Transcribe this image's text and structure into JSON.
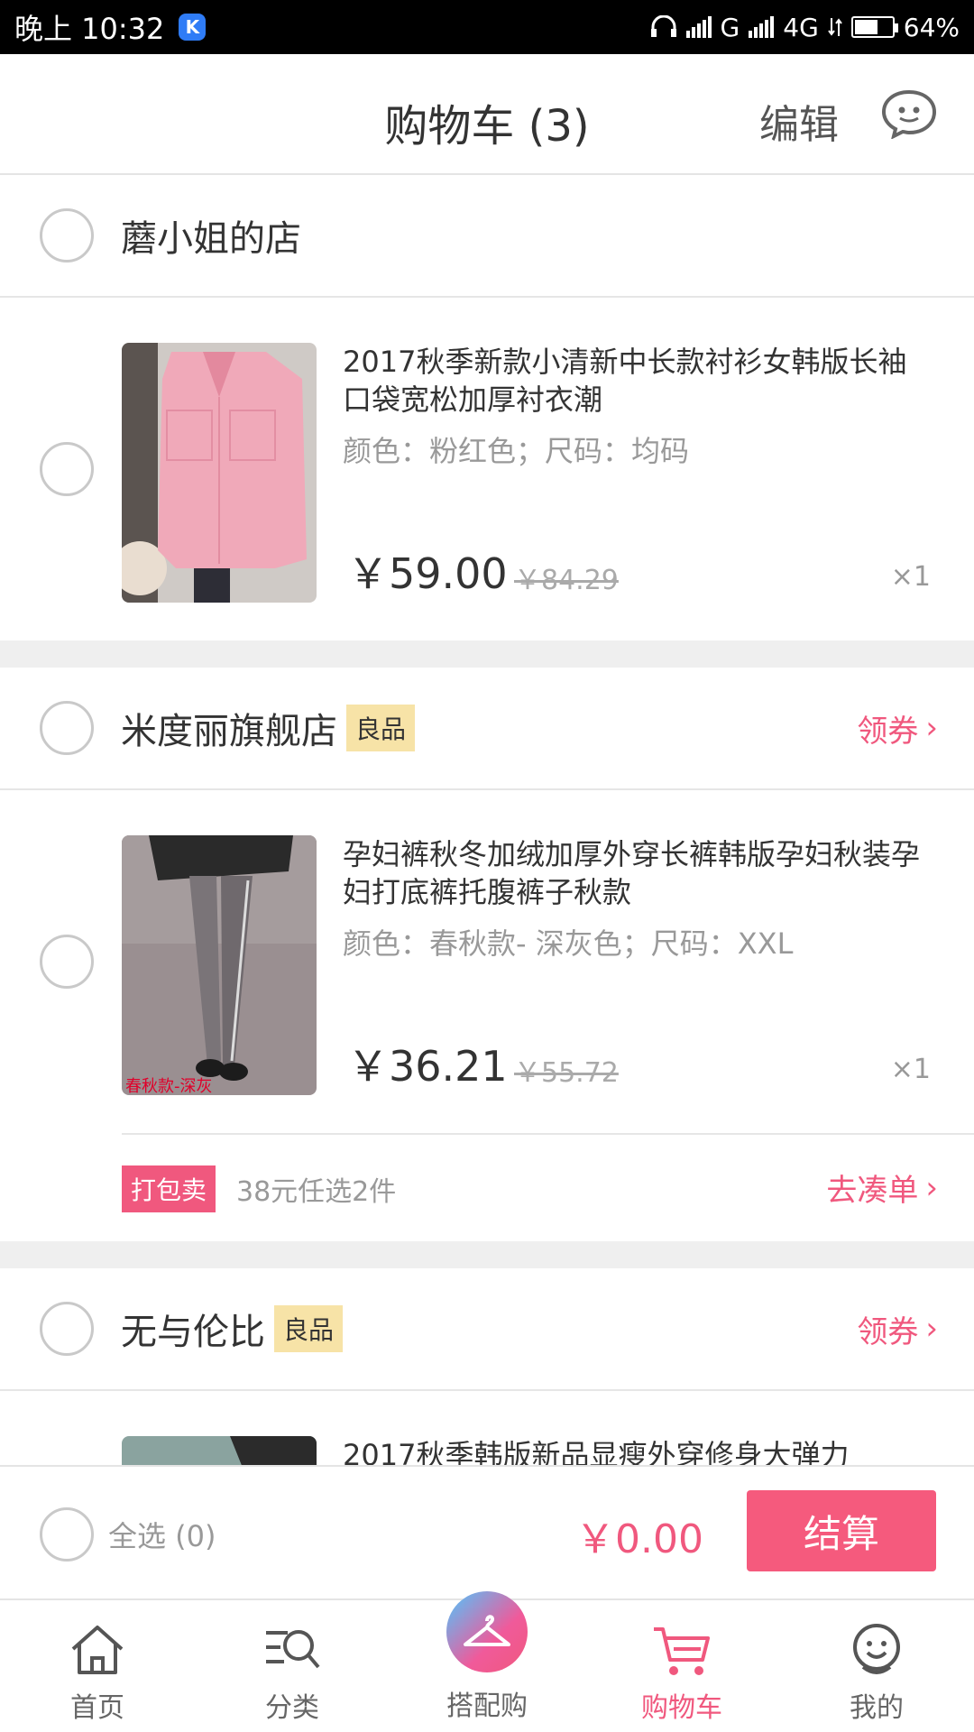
{
  "status_bar": {
    "time": "晚上 10:32",
    "network": "G",
    "network2": "4G",
    "battery": "64%",
    "battery_level": 0.64
  },
  "header": {
    "title": "购物车 (3)",
    "edit": "编辑"
  },
  "shops": [
    {
      "name": "蘑小姐的店",
      "items": [
        {
          "name": "2017秋季新款小清新中长款衬衫女韩版长袖口袋宽松加厚衬衣潮",
          "spec": "颜色：粉红色；尺码：均码",
          "price": "￥59.00",
          "original_price": "￥84.29",
          "qty": "×1"
        }
      ]
    },
    {
      "name": "米度丽旗舰店",
      "tag": "良品",
      "coupon": "领券",
      "items": [
        {
          "name": "孕妇裤秋冬加绒加厚外穿长裤韩版孕妇秋装孕妇打底裤托腹裤子秋款",
          "spec": "颜色：春秋款- 深灰色；尺码：XXL",
          "price": "￥36.21",
          "original_price": "￥55.72",
          "qty": "×1",
          "image_caption": "春秋款-深灰"
        }
      ],
      "bundle": {
        "badge": "打包卖",
        "desc": "38元任选2件",
        "action": "去凑单"
      }
    },
    {
      "name": "无与伦比",
      "tag": "良品",
      "coupon": "领券",
      "items": [
        {
          "name": "2017秋季韩版新品显瘦外穿修身大弹力"
        }
      ]
    }
  ],
  "checkout": {
    "select_all": "全选 (0)",
    "total": "￥0.00",
    "button": "结算"
  },
  "tabbar": {
    "tabs": [
      {
        "label": "首页",
        "icon": "home-icon"
      },
      {
        "label": "分类",
        "icon": "category-search-icon"
      },
      {
        "label": "搭配购",
        "icon": "hanger-icon"
      },
      {
        "label": "购物车",
        "icon": "cart-icon"
      },
      {
        "label": "我的",
        "icon": "profile-icon"
      }
    ],
    "active": 3
  },
  "colors": {
    "accent": "#f0587e",
    "tag_good_bg": "#f7e3a7",
    "divider_gap": "#efefef"
  }
}
